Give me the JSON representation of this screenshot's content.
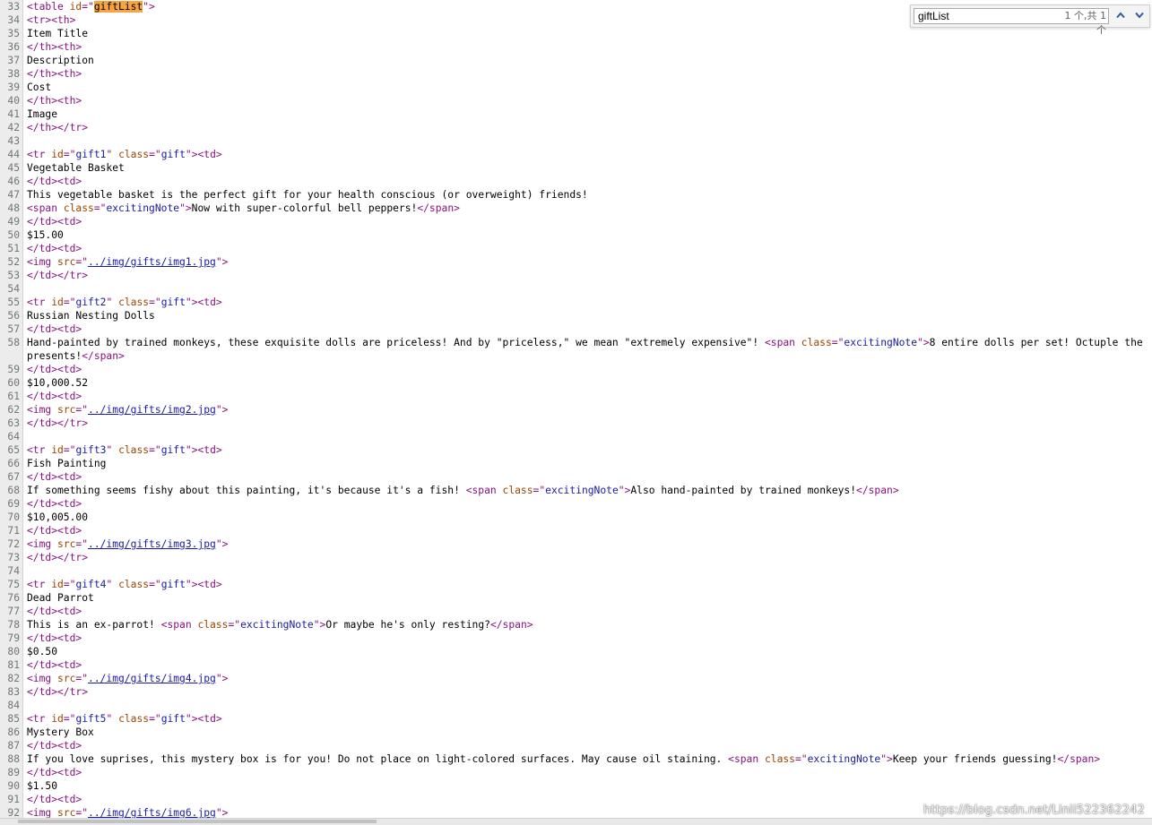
{
  "find": {
    "query": "giftList",
    "match_count": "1 个,共 1 个"
  },
  "watermark": "https://blog.csdn.net/Linli522362242",
  "lines": [
    {
      "n": "33",
      "segs": [
        [
          "t",
          "<table "
        ],
        [
          "an",
          "id"
        ],
        [
          "t",
          "=\""
        ],
        [
          "hl",
          "giftList"
        ],
        [
          "t",
          "\">"
        ]
      ]
    },
    {
      "n": "34",
      "segs": [
        [
          "t",
          "<tr><th>"
        ]
      ]
    },
    {
      "n": "35",
      "segs": [
        [
          "tx",
          "Item Title"
        ]
      ]
    },
    {
      "n": "36",
      "segs": [
        [
          "t",
          "</th><th>"
        ]
      ]
    },
    {
      "n": "37",
      "segs": [
        [
          "tx",
          "Description"
        ]
      ]
    },
    {
      "n": "38",
      "segs": [
        [
          "t",
          "</th><th>"
        ]
      ]
    },
    {
      "n": "39",
      "segs": [
        [
          "tx",
          "Cost"
        ]
      ]
    },
    {
      "n": "40",
      "segs": [
        [
          "t",
          "</th><th>"
        ]
      ]
    },
    {
      "n": "41",
      "segs": [
        [
          "tx",
          "Image"
        ]
      ]
    },
    {
      "n": "42",
      "segs": [
        [
          "t",
          "</th></tr>"
        ]
      ]
    },
    {
      "n": "43",
      "segs": []
    },
    {
      "n": "44",
      "segs": [
        [
          "t",
          "<tr "
        ],
        [
          "an",
          "id"
        ],
        [
          "t",
          "=\""
        ],
        [
          "av",
          "gift1"
        ],
        [
          "t",
          "\" "
        ],
        [
          "an",
          "class"
        ],
        [
          "t",
          "=\""
        ],
        [
          "av",
          "gift"
        ],
        [
          "t",
          "\"><td>"
        ]
      ]
    },
    {
      "n": "45",
      "segs": [
        [
          "tx",
          "Vegetable Basket"
        ]
      ]
    },
    {
      "n": "46",
      "segs": [
        [
          "t",
          "</td><td>"
        ]
      ]
    },
    {
      "n": "47",
      "segs": [
        [
          "tx",
          "This vegetable basket is the perfect gift for your health conscious (or overweight) friends!"
        ]
      ]
    },
    {
      "n": "48",
      "segs": [
        [
          "t",
          "<span "
        ],
        [
          "an",
          "class"
        ],
        [
          "t",
          "=\""
        ],
        [
          "av",
          "excitingNote"
        ],
        [
          "t",
          "\">"
        ],
        [
          "tx",
          "Now with super-colorful bell peppers!"
        ],
        [
          "t",
          "</span>"
        ]
      ]
    },
    {
      "n": "49",
      "segs": [
        [
          "t",
          "</td><td>"
        ]
      ]
    },
    {
      "n": "50",
      "segs": [
        [
          "tx",
          "$15.00"
        ]
      ]
    },
    {
      "n": "51",
      "segs": [
        [
          "t",
          "</td><td>"
        ]
      ]
    },
    {
      "n": "52",
      "segs": [
        [
          "t",
          "<img "
        ],
        [
          "an",
          "src"
        ],
        [
          "t",
          "=\""
        ],
        [
          "lk",
          "../img/gifts/img1.jpg"
        ],
        [
          "t",
          "\">"
        ]
      ]
    },
    {
      "n": "53",
      "segs": [
        [
          "t",
          "</td></tr>"
        ]
      ]
    },
    {
      "n": "54",
      "segs": []
    },
    {
      "n": "55",
      "segs": [
        [
          "t",
          "<tr "
        ],
        [
          "an",
          "id"
        ],
        [
          "t",
          "=\""
        ],
        [
          "av",
          "gift2"
        ],
        [
          "t",
          "\" "
        ],
        [
          "an",
          "class"
        ],
        [
          "t",
          "=\""
        ],
        [
          "av",
          "gift"
        ],
        [
          "t",
          "\"><td>"
        ]
      ]
    },
    {
      "n": "56",
      "segs": [
        [
          "tx",
          "Russian Nesting Dolls"
        ]
      ]
    },
    {
      "n": "57",
      "segs": [
        [
          "t",
          "</td><td>"
        ]
      ]
    },
    {
      "n": "58",
      "tall": true,
      "segs": [
        [
          "tx",
          "Hand-painted by trained monkeys, these exquisite dolls are priceless! And by \"priceless,\" we mean \"extremely expensive\"! "
        ],
        [
          "t",
          "<span "
        ],
        [
          "an",
          "class"
        ],
        [
          "t",
          "=\""
        ],
        [
          "av",
          "excitingNote"
        ],
        [
          "t",
          "\">"
        ],
        [
          "tx",
          "8 entire dolls per set! Octuple the presents!"
        ],
        [
          "t",
          "</span>"
        ]
      ]
    },
    {
      "n": "59",
      "segs": [
        [
          "t",
          "</td><td>"
        ]
      ]
    },
    {
      "n": "60",
      "segs": [
        [
          "tx",
          "$10,000.52"
        ]
      ]
    },
    {
      "n": "61",
      "segs": [
        [
          "t",
          "</td><td>"
        ]
      ]
    },
    {
      "n": "62",
      "segs": [
        [
          "t",
          "<img "
        ],
        [
          "an",
          "src"
        ],
        [
          "t",
          "=\""
        ],
        [
          "lk",
          "../img/gifts/img2.jpg"
        ],
        [
          "t",
          "\">"
        ]
      ]
    },
    {
      "n": "63",
      "segs": [
        [
          "t",
          "</td></tr>"
        ]
      ]
    },
    {
      "n": "64",
      "segs": []
    },
    {
      "n": "65",
      "segs": [
        [
          "t",
          "<tr "
        ],
        [
          "an",
          "id"
        ],
        [
          "t",
          "=\""
        ],
        [
          "av",
          "gift3"
        ],
        [
          "t",
          "\" "
        ],
        [
          "an",
          "class"
        ],
        [
          "t",
          "=\""
        ],
        [
          "av",
          "gift"
        ],
        [
          "t",
          "\"><td>"
        ]
      ]
    },
    {
      "n": "66",
      "segs": [
        [
          "tx",
          "Fish Painting"
        ]
      ]
    },
    {
      "n": "67",
      "segs": [
        [
          "t",
          "</td><td>"
        ]
      ]
    },
    {
      "n": "68",
      "segs": [
        [
          "tx",
          "If something seems fishy about this painting, it's because it's a fish! "
        ],
        [
          "t",
          "<span "
        ],
        [
          "an",
          "class"
        ],
        [
          "t",
          "=\""
        ],
        [
          "av",
          "excitingNote"
        ],
        [
          "t",
          "\">"
        ],
        [
          "tx",
          "Also hand-painted by trained monkeys!"
        ],
        [
          "t",
          "</span>"
        ]
      ]
    },
    {
      "n": "69",
      "segs": [
        [
          "t",
          "</td><td>"
        ]
      ]
    },
    {
      "n": "70",
      "segs": [
        [
          "tx",
          "$10,005.00"
        ]
      ]
    },
    {
      "n": "71",
      "segs": [
        [
          "t",
          "</td><td>"
        ]
      ]
    },
    {
      "n": "72",
      "segs": [
        [
          "t",
          "<img "
        ],
        [
          "an",
          "src"
        ],
        [
          "t",
          "=\""
        ],
        [
          "lk",
          "../img/gifts/img3.jpg"
        ],
        [
          "t",
          "\">"
        ]
      ]
    },
    {
      "n": "73",
      "segs": [
        [
          "t",
          "</td></tr>"
        ]
      ]
    },
    {
      "n": "74",
      "segs": []
    },
    {
      "n": "75",
      "segs": [
        [
          "t",
          "<tr "
        ],
        [
          "an",
          "id"
        ],
        [
          "t",
          "=\""
        ],
        [
          "av",
          "gift4"
        ],
        [
          "t",
          "\" "
        ],
        [
          "an",
          "class"
        ],
        [
          "t",
          "=\""
        ],
        [
          "av",
          "gift"
        ],
        [
          "t",
          "\"><td>"
        ]
      ]
    },
    {
      "n": "76",
      "segs": [
        [
          "tx",
          "Dead Parrot"
        ]
      ]
    },
    {
      "n": "77",
      "segs": [
        [
          "t",
          "</td><td>"
        ]
      ]
    },
    {
      "n": "78",
      "segs": [
        [
          "tx",
          "This is an ex-parrot! "
        ],
        [
          "t",
          "<span "
        ],
        [
          "an",
          "class"
        ],
        [
          "t",
          "=\""
        ],
        [
          "av",
          "excitingNote"
        ],
        [
          "t",
          "\">"
        ],
        [
          "tx",
          "Or maybe he's only resting?"
        ],
        [
          "t",
          "</span>"
        ]
      ]
    },
    {
      "n": "79",
      "segs": [
        [
          "t",
          "</td><td>"
        ]
      ]
    },
    {
      "n": "80",
      "segs": [
        [
          "tx",
          "$0.50"
        ]
      ]
    },
    {
      "n": "81",
      "segs": [
        [
          "t",
          "</td><td>"
        ]
      ]
    },
    {
      "n": "82",
      "segs": [
        [
          "t",
          "<img "
        ],
        [
          "an",
          "src"
        ],
        [
          "t",
          "=\""
        ],
        [
          "lk",
          "../img/gifts/img4.jpg"
        ],
        [
          "t",
          "\">"
        ]
      ]
    },
    {
      "n": "83",
      "segs": [
        [
          "t",
          "</td></tr>"
        ]
      ]
    },
    {
      "n": "84",
      "segs": []
    },
    {
      "n": "85",
      "segs": [
        [
          "t",
          "<tr "
        ],
        [
          "an",
          "id"
        ],
        [
          "t",
          "=\""
        ],
        [
          "av",
          "gift5"
        ],
        [
          "t",
          "\" "
        ],
        [
          "an",
          "class"
        ],
        [
          "t",
          "=\""
        ],
        [
          "av",
          "gift"
        ],
        [
          "t",
          "\"><td>"
        ]
      ]
    },
    {
      "n": "86",
      "segs": [
        [
          "tx",
          "Mystery Box"
        ]
      ]
    },
    {
      "n": "87",
      "segs": [
        [
          "t",
          "</td><td>"
        ]
      ]
    },
    {
      "n": "88",
      "segs": [
        [
          "tx",
          "If you love suprises, this mystery box is for you! Do not place on light-colored surfaces. May cause oil staining. "
        ],
        [
          "t",
          "<span "
        ],
        [
          "an",
          "class"
        ],
        [
          "t",
          "=\""
        ],
        [
          "av",
          "excitingNote"
        ],
        [
          "t",
          "\">"
        ],
        [
          "tx",
          "Keep your friends guessing!"
        ],
        [
          "t",
          "</span>"
        ]
      ]
    },
    {
      "n": "89",
      "segs": [
        [
          "t",
          "</td><td>"
        ]
      ]
    },
    {
      "n": "90",
      "segs": [
        [
          "tx",
          "$1.50"
        ]
      ]
    },
    {
      "n": "91",
      "segs": [
        [
          "t",
          "</td><td>"
        ]
      ]
    },
    {
      "n": "92",
      "segs": [
        [
          "t",
          "<img "
        ],
        [
          "an",
          "src"
        ],
        [
          "t",
          "=\""
        ],
        [
          "lk",
          "../img/gifts/img6.jpg"
        ],
        [
          "t",
          "\">"
        ]
      ]
    }
  ]
}
